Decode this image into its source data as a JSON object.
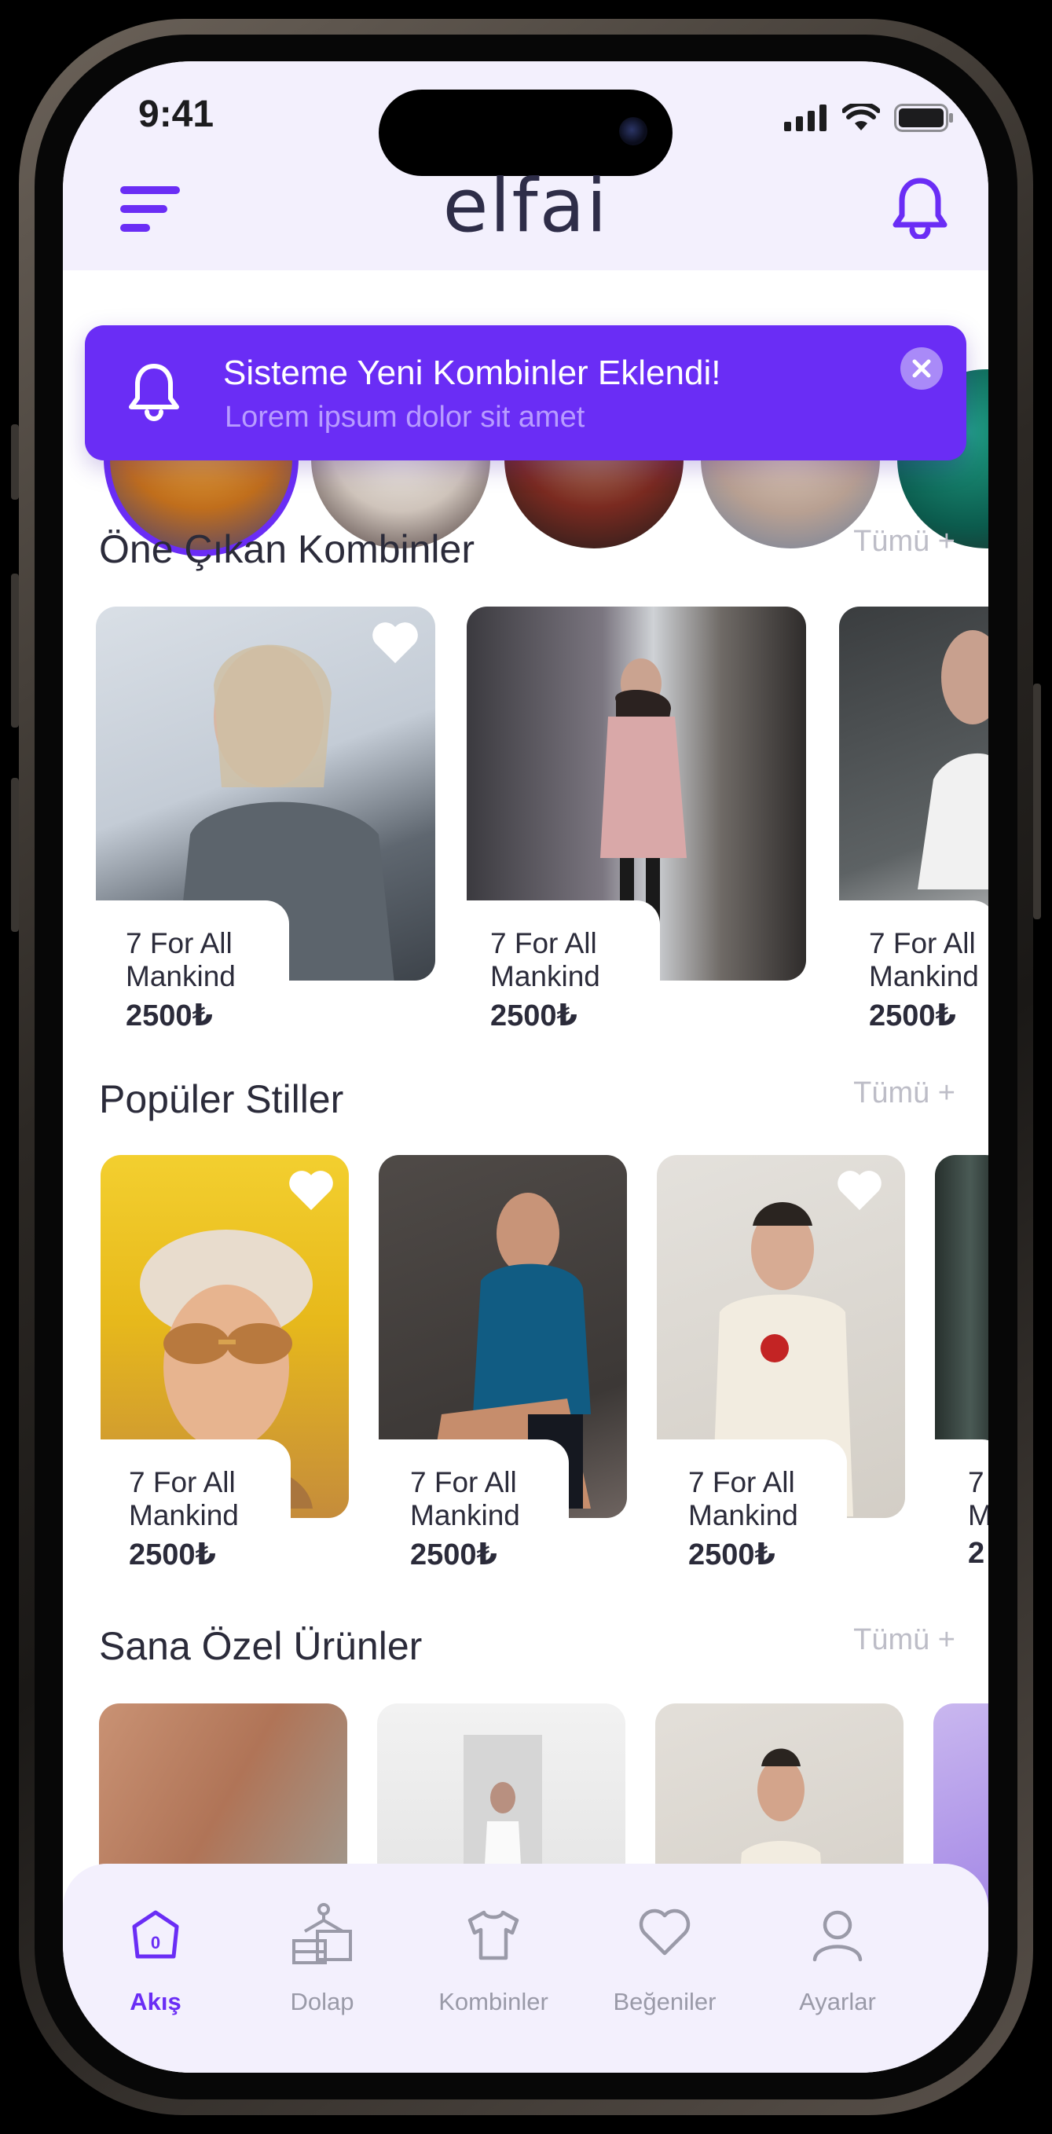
{
  "status": {
    "time": "9:41"
  },
  "header": {
    "logo": "elfai"
  },
  "toast": {
    "title": "Sisteme Yeni Kombinler Eklendi!",
    "subtitle": "Lorem ipsum dolor sit amet"
  },
  "sections": {
    "featured": {
      "title": "Öne Çıkan Kombinler",
      "see_all": "Tümü +",
      "items": [
        {
          "brand_line1": "7 For All",
          "brand_line2": "Mankind",
          "price": "2500₺"
        },
        {
          "brand_line1": "7 For All",
          "brand_line2": "Mankind",
          "price": "2500₺"
        },
        {
          "brand_line1": "7 For All",
          "brand_line2": "Mankind",
          "price": "2500₺"
        }
      ]
    },
    "popular": {
      "title": "Popüler Stiller",
      "see_all": "Tümü +",
      "items": [
        {
          "brand_line1": "7 For All",
          "brand_line2": "Mankind",
          "price": "2500₺"
        },
        {
          "brand_line1": "7 For All",
          "brand_line2": "Mankind",
          "price": "2500₺"
        },
        {
          "brand_line1": "7 For All",
          "brand_line2": "Mankind",
          "price": "2500₺"
        },
        {
          "brand_line1": "7",
          "brand_line2": "M",
          "price": "2"
        }
      ]
    },
    "for_you": {
      "title": "Sana Özel Ürünler",
      "see_all": "Tümü +"
    }
  },
  "tabbar": {
    "active_tab": "Akış",
    "badge": "0",
    "tabs": [
      {
        "label": "Akış",
        "icon": "home-icon"
      },
      {
        "label": "Dolap",
        "icon": "wardrobe-icon"
      },
      {
        "label": "Kombinler",
        "icon": "tshirt-icon"
      },
      {
        "label": "Beğeniler",
        "icon": "heart-icon"
      },
      {
        "label": "Ayarlar",
        "icon": "user-icon"
      }
    ]
  },
  "colors": {
    "accent": "#6a2df5",
    "header_bg": "#f3f0fd",
    "text": "#2b2b3a",
    "muted": "#bdbdc7"
  }
}
